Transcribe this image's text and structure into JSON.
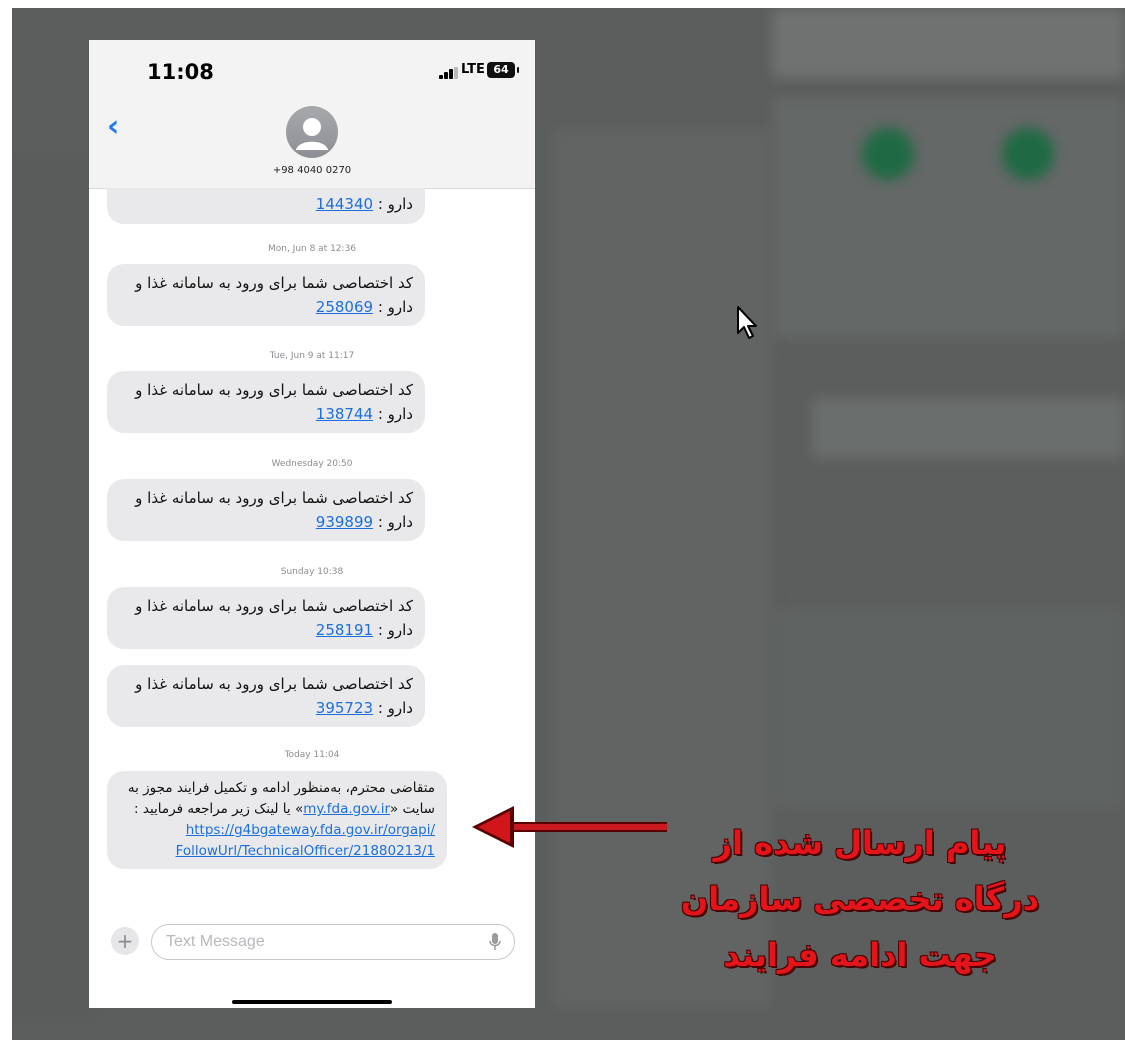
{
  "status_bar": {
    "time": "11:08",
    "network": "LTE",
    "battery": "64"
  },
  "header": {
    "contact": "+98 4040 0270"
  },
  "messages": [
    {
      "partial_text": "دارو : ",
      "code": "144340"
    },
    {
      "timestamp": "Mon, Jun 8 at 12:36",
      "text": "کد اختصاصی شما برای ورود به سامانه غذا و دارو : ",
      "code": "258069"
    },
    {
      "timestamp": "Tue, Jun 9 at 11:17",
      "text": "کد اختصاصی شما برای ورود به سامانه غذا و دارو : ",
      "code": "138744"
    },
    {
      "timestamp": "Wednesday 20:50",
      "text": "کد اختصاصی شما برای ورود به سامانه غذا و دارو : ",
      "code": "939899"
    },
    {
      "timestamp": "Sunday 10:38",
      "text": "کد اختصاصی شما برای ورود به سامانه غذا و دارو : ",
      "code": "258191"
    },
    {
      "text": "کد اختصاصی شما برای ورود به سامانه غذا و دارو : ",
      "code": "395723"
    }
  ],
  "final_message": {
    "timestamp": "Today 11:04",
    "text_before_link": "متقاضی محترم، به‌منظور ادامه و تکمیل فرایند مجوز به سایت «",
    "site_link": "my.fda.gov.ir",
    "text_after_link": "» یا لینک زیر مراجعه فرمایید :",
    "url_line1": "https://g4bgateway.fda.gov.ir/orgapi/",
    "url_line2": "FollowUrl/TechnicalOfficer/21880213/1"
  },
  "input": {
    "placeholder": "Text Message"
  },
  "annotation": {
    "line1": "پیام ارسال شده از",
    "line2": "درگاه تخصصی سازمان",
    "line3": "جهت ادامه فرایند",
    "color": "#e3151b"
  },
  "colors": {
    "link": "#1b6fdc",
    "bubble": "#e9e9eb",
    "back": "#1d7cf2"
  },
  "icons": [
    "back-chevron-icon",
    "avatar-icon",
    "signal-icon",
    "battery-icon",
    "plus-icon",
    "mic-icon",
    "arrow-icon",
    "mouse-cursor-icon"
  ]
}
